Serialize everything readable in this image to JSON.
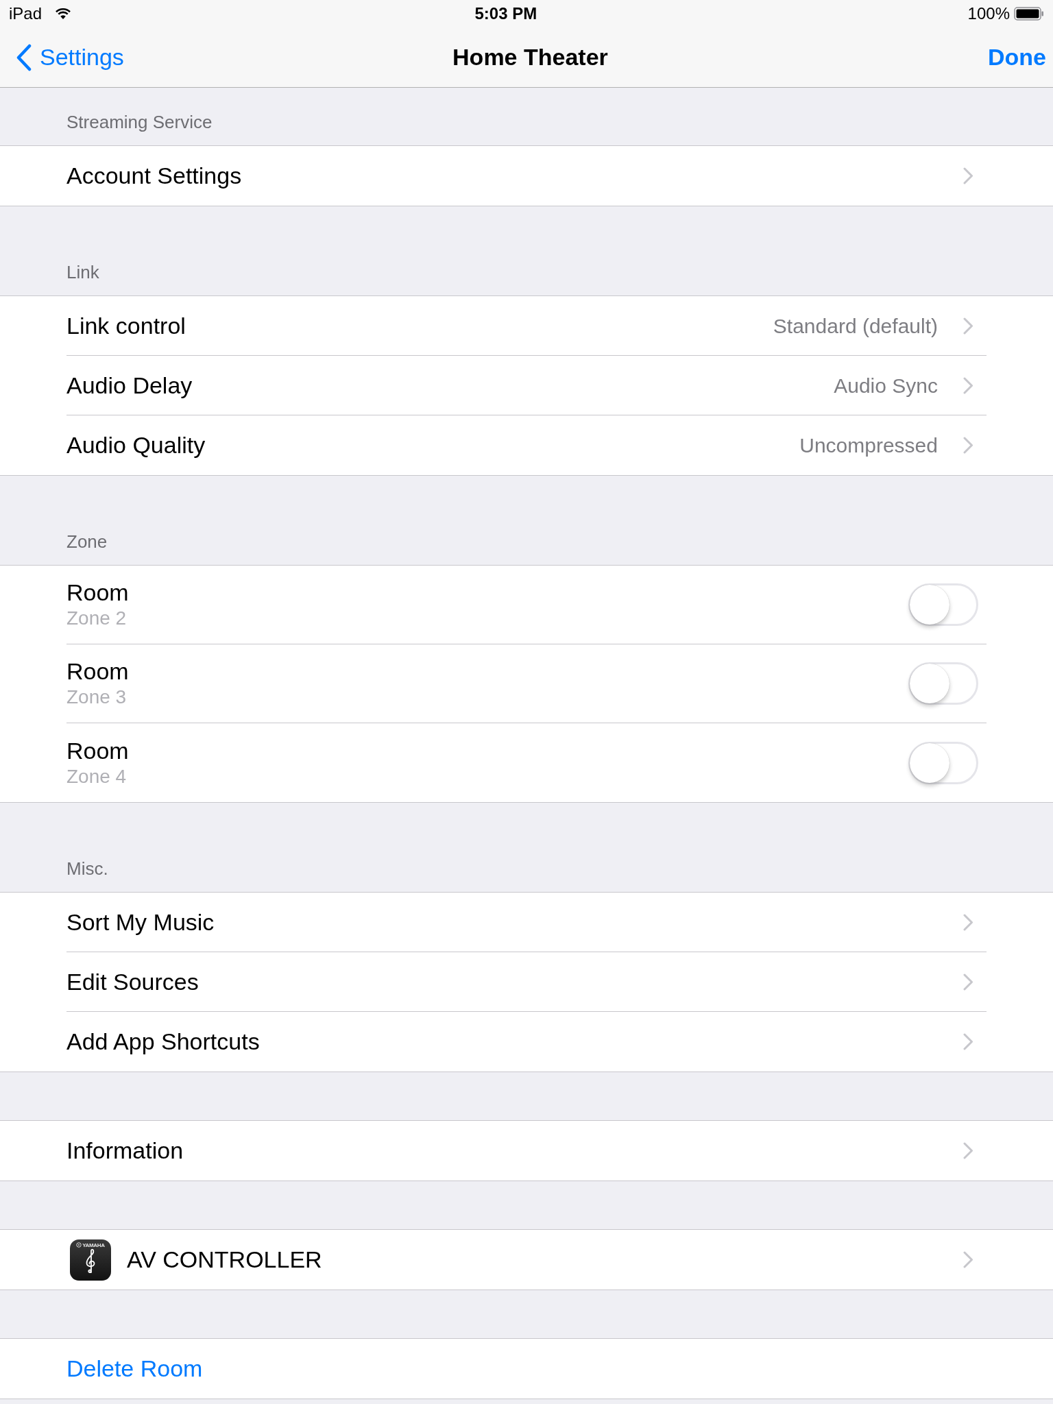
{
  "status_bar": {
    "device": "iPad",
    "time": "5:03 PM",
    "battery": "100%"
  },
  "nav_bar": {
    "back": "Settings",
    "title": "Home Theater",
    "action": "Done"
  },
  "sections": [
    {
      "header": "Streaming Service",
      "rows": [
        {
          "kind": "link",
          "label": "Account Settings"
        }
      ]
    },
    {
      "header": "Link",
      "rows": [
        {
          "kind": "link",
          "label": "Link control",
          "value": "Standard (default)"
        },
        {
          "kind": "link",
          "label": "Audio Delay",
          "value": "Audio Sync"
        },
        {
          "kind": "link",
          "label": "Audio Quality",
          "value": "Uncompressed"
        }
      ]
    },
    {
      "header": "Zone",
      "rows": [
        {
          "kind": "toggle",
          "label": "Room",
          "subtitle": "Zone 2",
          "on": false
        },
        {
          "kind": "toggle",
          "label": "Room",
          "subtitle": "Zone 3",
          "on": false
        },
        {
          "kind": "toggle",
          "label": "Room",
          "subtitle": "Zone 4",
          "on": false
        }
      ]
    },
    {
      "header": "Misc.",
      "rows": [
        {
          "kind": "link",
          "label": "Sort My Music"
        },
        {
          "kind": "link",
          "label": "Edit Sources"
        },
        {
          "kind": "link",
          "label": "Add App Shortcuts"
        }
      ]
    },
    {
      "rows": [
        {
          "kind": "link",
          "label": "Information"
        }
      ]
    },
    {
      "rows": [
        {
          "kind": "app",
          "label": "AV CONTROLLER",
          "icon_text": "YAMAHA"
        }
      ]
    },
    {
      "rows": [
        {
          "kind": "action",
          "label": "Delete Room"
        }
      ]
    }
  ]
}
